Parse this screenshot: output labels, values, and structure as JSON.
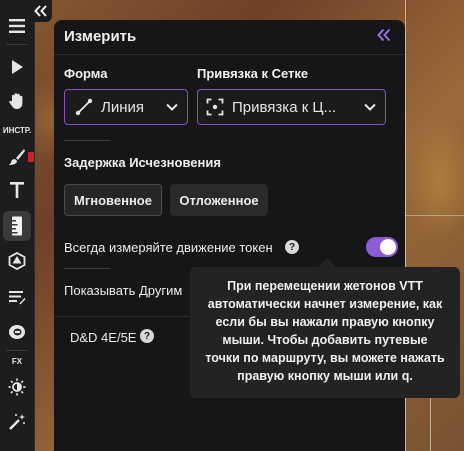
{
  "toolbar": {
    "section_tools_label": "ИНСТР.",
    "section_fx_label": "FX",
    "icons": [
      "menu-icon",
      "pointer-icon",
      "hand-icon",
      "brush-icon",
      "text-icon",
      "ruler-icon",
      "dice-icon",
      "notes-icon",
      "token-icon",
      "lighting-icon",
      "magic-wand-icon"
    ],
    "accent_color": "#cc2222"
  },
  "panel": {
    "title": "Измерить",
    "shape": {
      "label": "Форма",
      "value": "Линия"
    },
    "snap": {
      "label": "Привязка к Сетке",
      "value": "Привязка к Ц..."
    },
    "fade_delay": {
      "label": "Задержка Исчезновения",
      "options": [
        "Мгновенное",
        "Отложенное"
      ],
      "selected": "Мгновенное"
    },
    "always_measure": {
      "label": "Всегда измеряйте движение токен",
      "enabled": true
    },
    "show_others": {
      "label": "Показывать Другим"
    },
    "ruleset": {
      "label": "D&D 4E/5E"
    },
    "help_glyph": "?",
    "accent": "#8e5ad6"
  },
  "tooltip": {
    "lines": [
      "При перемещении жетонов VTT",
      "автоматически начнет измерение, как",
      "если бы вы нажали правую кнопку",
      "мыши. Чтобы добавить путевые",
      "точки по маршруту, вы можете нажать",
      "правую кнопку мыши или q."
    ]
  }
}
